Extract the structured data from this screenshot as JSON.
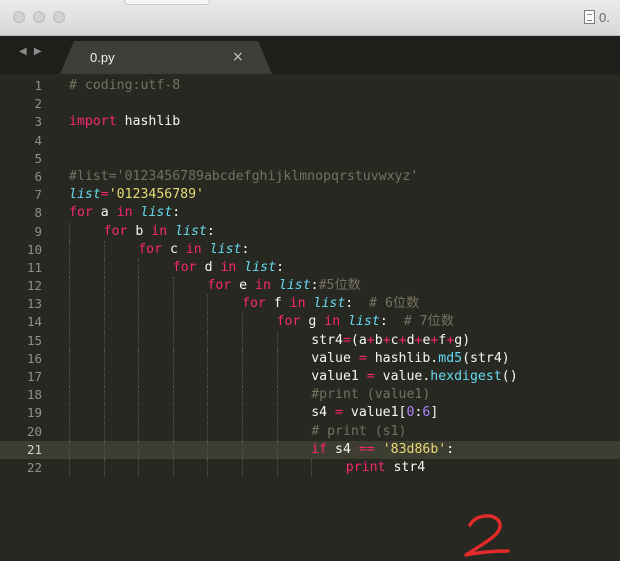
{
  "window": {
    "title": "0."
  },
  "tab": {
    "label": "0.py",
    "close_glyph": "×"
  },
  "icons": {
    "nav": "nav-arrows-icon",
    "doc": "document-icon",
    "close": "close-icon"
  },
  "colors": {
    "bg": "#272822",
    "keyword": "#f92672",
    "comment": "#75715e",
    "string": "#e6db74",
    "number": "#ae81ff",
    "builtin": "#66d9ef",
    "text": "#f8f8f2",
    "annotation": "#e22a2a"
  },
  "current_line": 21,
  "annotation": "2",
  "lines": [
    {
      "n": "1",
      "indent": 0,
      "tokens": [
        {
          "t": "# coding:utf-8",
          "c": "c"
        }
      ]
    },
    {
      "n": "2",
      "indent": 0,
      "tokens": []
    },
    {
      "n": "3",
      "indent": 0,
      "tokens": [
        {
          "t": "import",
          "c": "k"
        },
        {
          "t": " hashlib",
          "c": "p"
        }
      ]
    },
    {
      "n": "4",
      "indent": 0,
      "tokens": []
    },
    {
      "n": "5",
      "indent": 0,
      "tokens": []
    },
    {
      "n": "6",
      "indent": 0,
      "tokens": [
        {
          "t": "#list='0123456789abcdefghijklmnopqrstuvwxyz'",
          "c": "c"
        }
      ]
    },
    {
      "n": "7",
      "indent": 0,
      "tokens": [
        {
          "t": "list",
          "c": "b"
        },
        {
          "t": "=",
          "c": "o"
        },
        {
          "t": "'0123456789'",
          "c": "s"
        }
      ]
    },
    {
      "n": "8",
      "indent": 0,
      "tokens": [
        {
          "t": "for",
          "c": "k"
        },
        {
          "t": " a ",
          "c": "p"
        },
        {
          "t": "in",
          "c": "k"
        },
        {
          "t": " ",
          "c": "p"
        },
        {
          "t": "list",
          "c": "b"
        },
        {
          "t": ":",
          "c": "p"
        }
      ]
    },
    {
      "n": "9",
      "indent": 1,
      "tokens": [
        {
          "t": "for",
          "c": "k"
        },
        {
          "t": " b ",
          "c": "p"
        },
        {
          "t": "in",
          "c": "k"
        },
        {
          "t": " ",
          "c": "p"
        },
        {
          "t": "list",
          "c": "b"
        },
        {
          "t": ":",
          "c": "p"
        }
      ]
    },
    {
      "n": "10",
      "indent": 2,
      "tokens": [
        {
          "t": "for",
          "c": "k"
        },
        {
          "t": " c ",
          "c": "p"
        },
        {
          "t": "in",
          "c": "k"
        },
        {
          "t": " ",
          "c": "p"
        },
        {
          "t": "list",
          "c": "b"
        },
        {
          "t": ":",
          "c": "p"
        }
      ]
    },
    {
      "n": "11",
      "indent": 3,
      "tokens": [
        {
          "t": "for",
          "c": "k"
        },
        {
          "t": " d ",
          "c": "p"
        },
        {
          "t": "in",
          "c": "k"
        },
        {
          "t": " ",
          "c": "p"
        },
        {
          "t": "list",
          "c": "b"
        },
        {
          "t": ":",
          "c": "p"
        }
      ]
    },
    {
      "n": "12",
      "indent": 4,
      "tokens": [
        {
          "t": "for",
          "c": "k"
        },
        {
          "t": " e ",
          "c": "p"
        },
        {
          "t": "in",
          "c": "k"
        },
        {
          "t": " ",
          "c": "p"
        },
        {
          "t": "list",
          "c": "b"
        },
        {
          "t": ":",
          "c": "p"
        },
        {
          "t": "#5位数",
          "c": "c"
        }
      ]
    },
    {
      "n": "13",
      "indent": 5,
      "tokens": [
        {
          "t": "for",
          "c": "k"
        },
        {
          "t": " f ",
          "c": "p"
        },
        {
          "t": "in",
          "c": "k"
        },
        {
          "t": " ",
          "c": "p"
        },
        {
          "t": "list",
          "c": "b"
        },
        {
          "t": ":  ",
          "c": "p"
        },
        {
          "t": "# 6位数",
          "c": "c"
        }
      ]
    },
    {
      "n": "14",
      "indent": 6,
      "tokens": [
        {
          "t": "for",
          "c": "k"
        },
        {
          "t": " g ",
          "c": "p"
        },
        {
          "t": "in",
          "c": "k"
        },
        {
          "t": " ",
          "c": "p"
        },
        {
          "t": "list",
          "c": "b"
        },
        {
          "t": ":  ",
          "c": "p"
        },
        {
          "t": "# 7位数",
          "c": "c"
        }
      ]
    },
    {
      "n": "15",
      "indent": 7,
      "tokens": [
        {
          "t": "str4",
          "c": "p"
        },
        {
          "t": "=",
          "c": "o"
        },
        {
          "t": "(a",
          "c": "p"
        },
        {
          "t": "+",
          "c": "o"
        },
        {
          "t": "b",
          "c": "p"
        },
        {
          "t": "+",
          "c": "o"
        },
        {
          "t": "c",
          "c": "p"
        },
        {
          "t": "+",
          "c": "o"
        },
        {
          "t": "d",
          "c": "p"
        },
        {
          "t": "+",
          "c": "o"
        },
        {
          "t": "e",
          "c": "p"
        },
        {
          "t": "+",
          "c": "o"
        },
        {
          "t": "f",
          "c": "p"
        },
        {
          "t": "+",
          "c": "o"
        },
        {
          "t": "g)",
          "c": "p"
        }
      ]
    },
    {
      "n": "16",
      "indent": 7,
      "tokens": [
        {
          "t": "value ",
          "c": "p"
        },
        {
          "t": "=",
          "c": "o"
        },
        {
          "t": " hashlib.",
          "c": "p"
        },
        {
          "t": "md5",
          "c": "f"
        },
        {
          "t": "(str4)",
          "c": "p"
        }
      ]
    },
    {
      "n": "17",
      "indent": 7,
      "tokens": [
        {
          "t": "value1 ",
          "c": "p"
        },
        {
          "t": "=",
          "c": "o"
        },
        {
          "t": " value.",
          "c": "p"
        },
        {
          "t": "hexdigest",
          "c": "f"
        },
        {
          "t": "()",
          "c": "p"
        }
      ]
    },
    {
      "n": "18",
      "indent": 7,
      "tokens": [
        {
          "t": "#print (value1)",
          "c": "c"
        }
      ]
    },
    {
      "n": "19",
      "indent": 7,
      "tokens": [
        {
          "t": "s4 ",
          "c": "p"
        },
        {
          "t": "=",
          "c": "o"
        },
        {
          "t": " value1[",
          "c": "p"
        },
        {
          "t": "0",
          "c": "n"
        },
        {
          "t": ":",
          "c": "p"
        },
        {
          "t": "6",
          "c": "n"
        },
        {
          "t": "]",
          "c": "p"
        }
      ]
    },
    {
      "n": "20",
      "indent": 7,
      "tokens": [
        {
          "t": "# print (s1)",
          "c": "c"
        }
      ]
    },
    {
      "n": "21",
      "indent": 7,
      "tokens": [
        {
          "t": "if",
          "c": "k"
        },
        {
          "t": " s4 ",
          "c": "p"
        },
        {
          "t": "==",
          "c": "o"
        },
        {
          "t": " ",
          "c": "p"
        },
        {
          "t": "'83d86b'",
          "c": "s"
        },
        {
          "t": ":",
          "c": "p"
        }
      ]
    },
    {
      "n": "22",
      "indent": 8,
      "tokens": [
        {
          "t": "print",
          "c": "k"
        },
        {
          "t": " str4",
          "c": "p"
        }
      ]
    }
  ]
}
